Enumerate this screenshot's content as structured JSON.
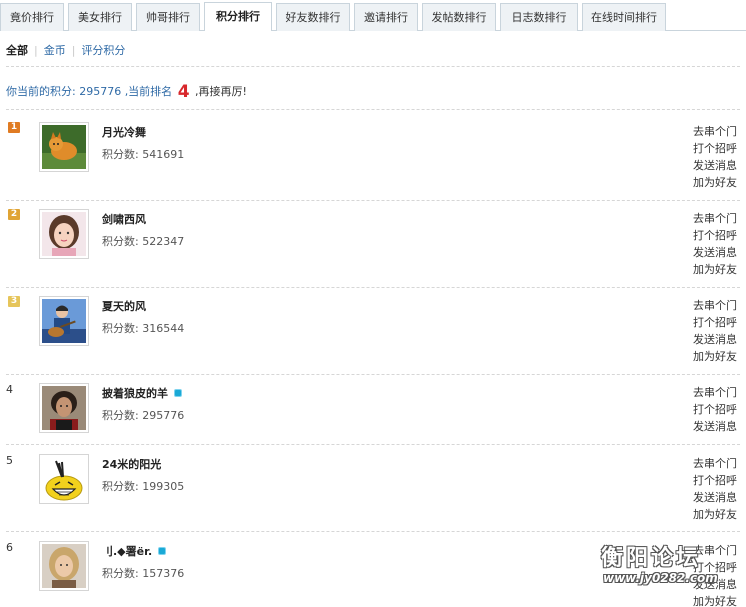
{
  "tabs": [
    {
      "label": "竟价排行",
      "active": false
    },
    {
      "label": "美女排行",
      "active": false
    },
    {
      "label": "帅哥排行",
      "active": false
    },
    {
      "label": "积分排行",
      "active": true
    },
    {
      "label": "好友数排行",
      "active": false
    },
    {
      "label": "邀请排行",
      "active": false
    },
    {
      "label": "发帖数排行",
      "active": false
    },
    {
      "label": "日志数排行",
      "active": false
    },
    {
      "label": "在线时间排行",
      "active": false
    }
  ],
  "filters": {
    "all": "全部",
    "gold": "金币",
    "rating": "评分积分"
  },
  "status": {
    "prefix": "你当前的积分: 295776 ,当前排名",
    "rank": "4",
    "suffix": ",再接再厉!"
  },
  "actions": {
    "visit": "去串个门",
    "greet": "打个招呼",
    "message": "发送消息",
    "add_friend": "加为好友"
  },
  "colors": {
    "rank_1": "#e07b22",
    "rank_2": "#e0a434",
    "rank_3": "#e6c55a",
    "link": "#2f6aa6",
    "rank_highlight": "#d8282c"
  },
  "rows": [
    {
      "rank": "1",
      "name": "月光冷舞",
      "points": "积分数: 541691",
      "vip": false,
      "badge": true,
      "avatar": "orange-cat-avatar"
    },
    {
      "rank": "2",
      "name": "剑啸西风",
      "points": "积分数: 522347",
      "vip": false,
      "badge": true,
      "avatar": "girl-portrait-avatar"
    },
    {
      "rank": "3",
      "name": "夏天的风",
      "points": "积分数: 316544",
      "vip": false,
      "badge": true,
      "avatar": "guitar-player-avatar"
    },
    {
      "rank": "4",
      "name": "披着狼皮的羊",
      "points": "积分数: 295776",
      "vip": true,
      "badge": false,
      "avatar": "man-photo-avatar"
    },
    {
      "rank": "5",
      "name": "24米的阳光",
      "points": "积分数: 199305",
      "vip": false,
      "badge": false,
      "avatar": "yellow-cartoon-avatar"
    },
    {
      "rank": "6",
      "name": "刂.◆署ër.",
      "points": "积分数: 157376",
      "vip": true,
      "badge": false,
      "avatar": "blonde-portrait-avatar"
    }
  ],
  "watermark": {
    "title": "衡阳论坛",
    "url": "www.jy0282.com"
  }
}
